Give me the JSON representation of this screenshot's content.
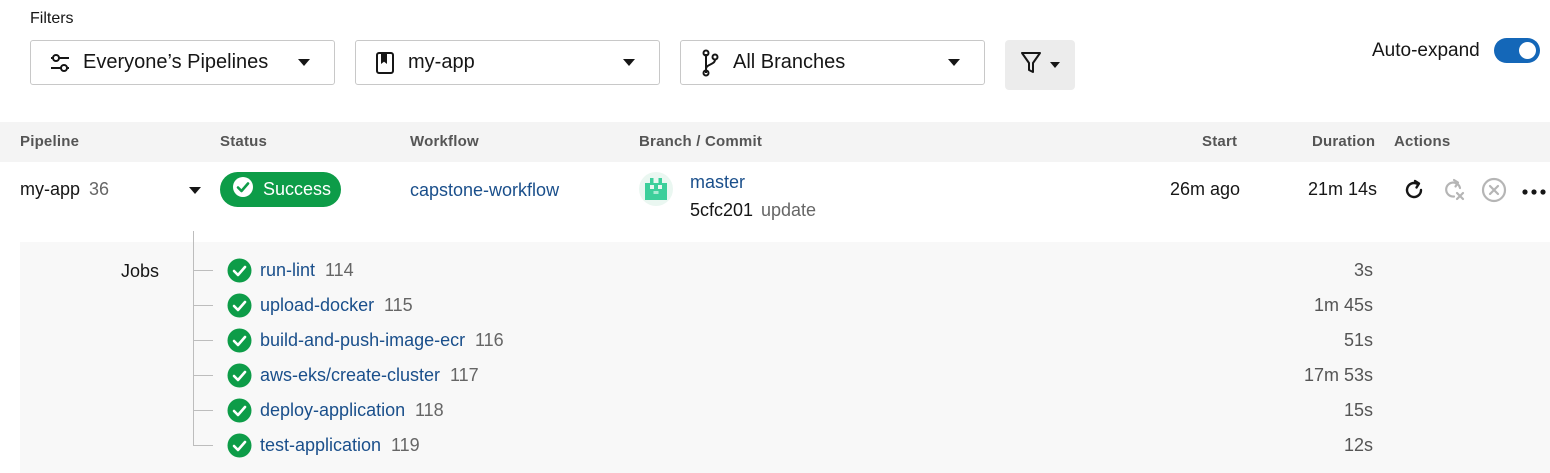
{
  "filters": {
    "title": "Filters",
    "pipelines_dropdown": "Everyone’s Pipelines",
    "project_dropdown": "my-app",
    "branch_dropdown": "All Branches",
    "auto_expand_label": "Auto-expand",
    "auto_expand_on": true
  },
  "columns": {
    "pipeline": "Pipeline",
    "status": "Status",
    "workflow": "Workflow",
    "branch_commit": "Branch / Commit",
    "start": "Start",
    "duration": "Duration",
    "actions": "Actions"
  },
  "pipeline": {
    "name": "my-app",
    "number": "36",
    "status": "Success",
    "workflow": "capstone-workflow",
    "branch": "master",
    "commit_hash": "5cfc201",
    "commit_message": "update",
    "start": "26m ago",
    "duration": "21m 14s"
  },
  "jobs": {
    "label": "Jobs",
    "items": [
      {
        "name": "run-lint",
        "number": "114",
        "duration": "3s"
      },
      {
        "name": "upload-docker",
        "number": "115",
        "duration": "1m 45s"
      },
      {
        "name": "build-and-push-image-ecr",
        "number": "116",
        "duration": "51s"
      },
      {
        "name": "aws-eks/create-cluster",
        "number": "117",
        "duration": "17m 53s"
      },
      {
        "name": "deploy-application",
        "number": "118",
        "duration": "15s"
      },
      {
        "name": "test-application",
        "number": "119",
        "duration": "12s"
      }
    ]
  },
  "colors": {
    "success_green": "#0d9c48",
    "link_blue": "#1a4f8b",
    "toggle_blue": "#1467b8"
  },
  "icons": {
    "pipelines_dropdown": "sliders-icon",
    "project_dropdown": "bookmark-book-icon",
    "branch_dropdown": "git-branch-icon",
    "filter_button": "funnel-icon",
    "actions": [
      "rerun-icon",
      "rerun-failed-icon",
      "cancel-icon",
      "more-icon"
    ]
  }
}
